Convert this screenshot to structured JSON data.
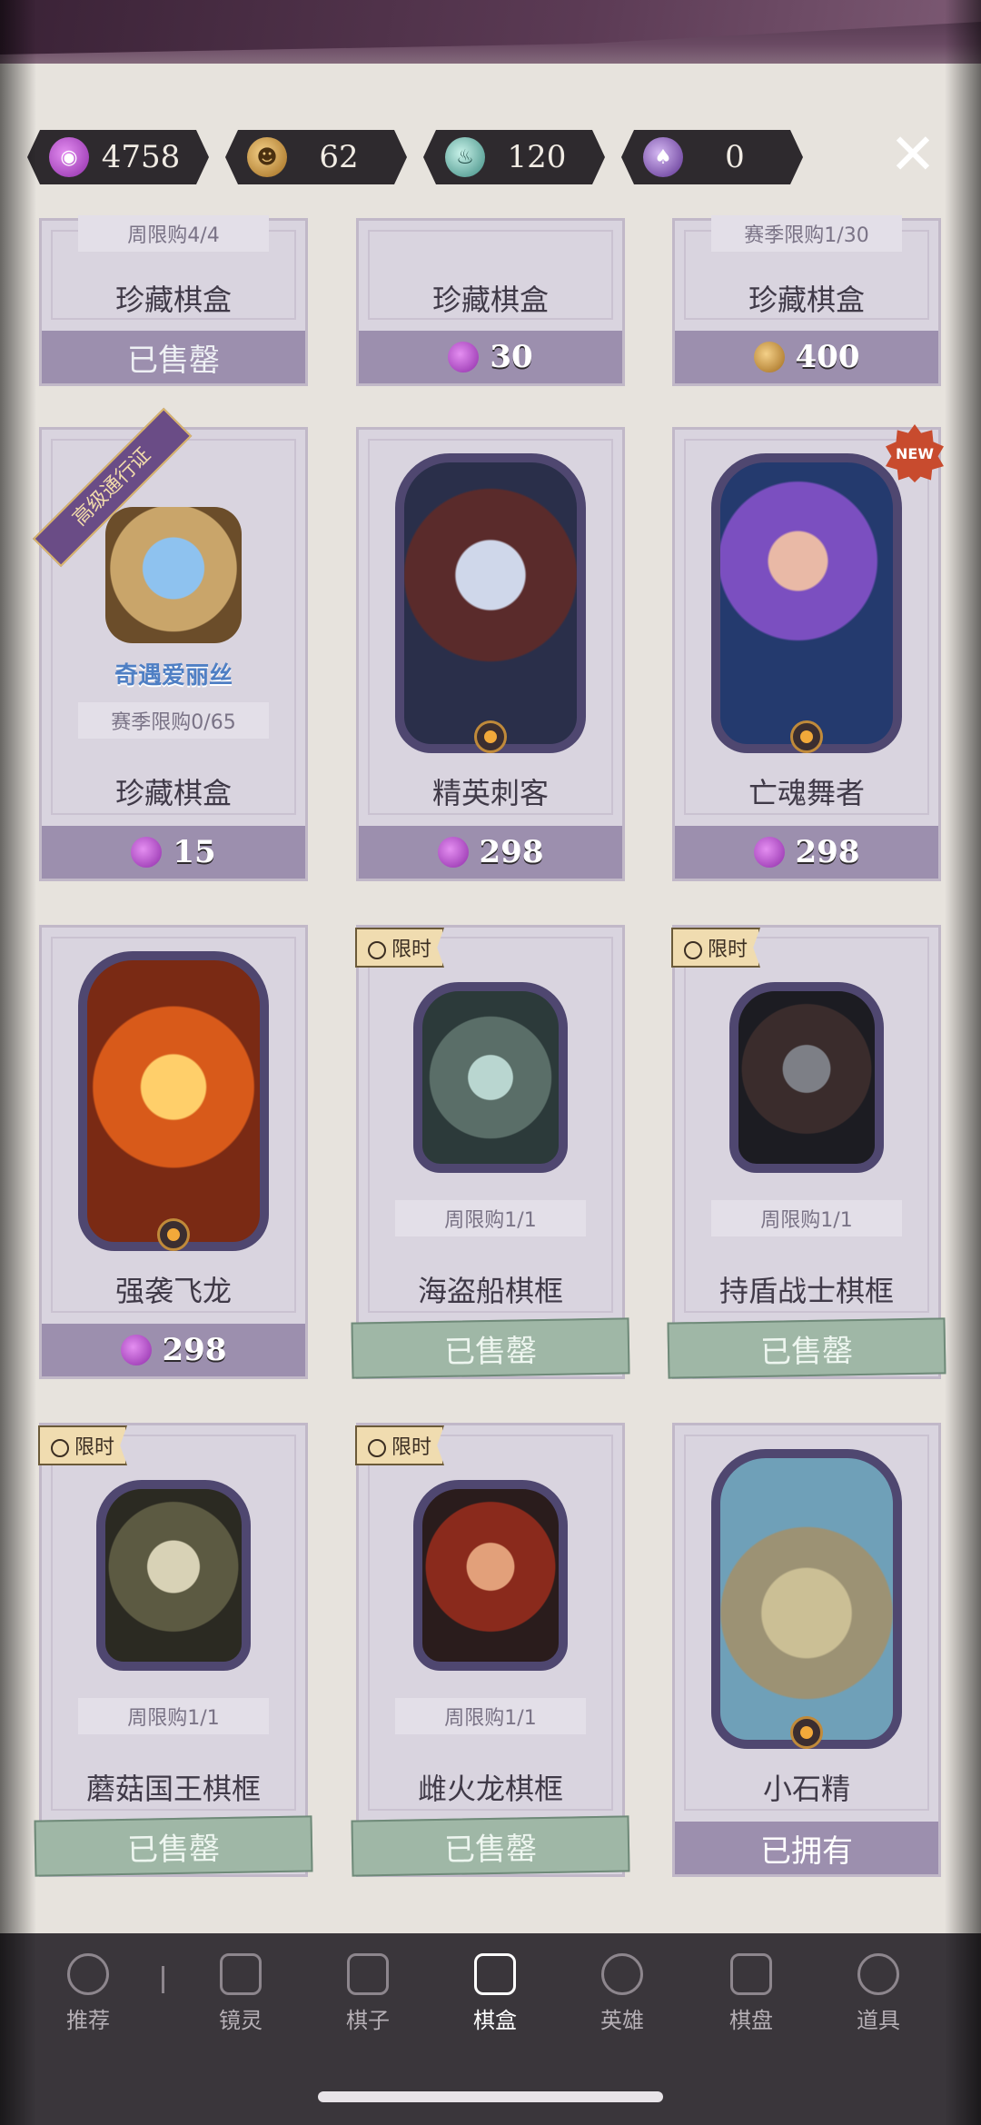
{
  "currencies": [
    {
      "icon": "candy-gem-icon",
      "value": "4758",
      "color": "#a43fc0"
    },
    {
      "icon": "pumpkin-coin-icon",
      "value": "62",
      "color": "#c58a30"
    },
    {
      "icon": "potion-bottle-icon",
      "value": "120",
      "color": "#5fb1a4"
    },
    {
      "icon": "dark-potion-icon",
      "value": "0",
      "color": "#7f4fb2"
    }
  ],
  "close_icon": "close-icon",
  "cards": {
    "r0c0": {
      "name": "珍藏棋盒",
      "limit": "周限购4/4",
      "footer": "已售罄"
    },
    "r0c1": {
      "name": "珍藏棋盒",
      "limit": "",
      "price": "30",
      "currency": "candy-gem-icon"
    },
    "r0c2": {
      "name": "珍藏棋盒",
      "limit": "赛季限购1/30",
      "price": "400",
      "currency": "pumpkin-coin-icon"
    },
    "r1c0": {
      "name": "珍藏棋盒",
      "limit": "赛季限购0/65",
      "ribbon": "高级通行证",
      "logo": "奇遇爱丽丝",
      "price": "15",
      "currency": "candy-gem-icon"
    },
    "r1c1": {
      "name": "精英刺客",
      "price": "298",
      "currency": "candy-gem-icon"
    },
    "r1c2": {
      "name": "亡魂舞者",
      "badge": "NEW",
      "price": "298",
      "currency": "candy-gem-icon"
    },
    "r2c0": {
      "name": "强袭飞龙",
      "price": "298",
      "currency": "candy-gem-icon"
    },
    "r2c1": {
      "name": "海盗船棋框",
      "tag": "限时",
      "limit": "周限购1/1",
      "footer": "已售罄"
    },
    "r2c2": {
      "name": "持盾战士棋框",
      "tag": "限时",
      "limit": "周限购1/1",
      "footer": "已售罄"
    },
    "r3c0": {
      "name": "蘑菇国王棋框",
      "tag": "限时",
      "limit": "周限购1/1",
      "footer": "已售罄"
    },
    "r3c1": {
      "name": "雌火龙棋框",
      "tag": "限时",
      "limit": "周限购1/1",
      "footer": "已售罄"
    },
    "r3c2": {
      "name": "小石精",
      "footer": "已拥有"
    }
  },
  "nav": [
    {
      "label": "推荐",
      "icon": "recommend-icon"
    },
    {
      "label": "镜灵",
      "icon": "spirit-icon"
    },
    {
      "label": "棋子",
      "icon": "piece-icon"
    },
    {
      "label": "棋盒",
      "icon": "box-icon",
      "active": true
    },
    {
      "label": "英雄",
      "icon": "hero-icon"
    },
    {
      "label": "棋盘",
      "icon": "board-icon"
    },
    {
      "label": "道具",
      "icon": "item-icon"
    }
  ]
}
